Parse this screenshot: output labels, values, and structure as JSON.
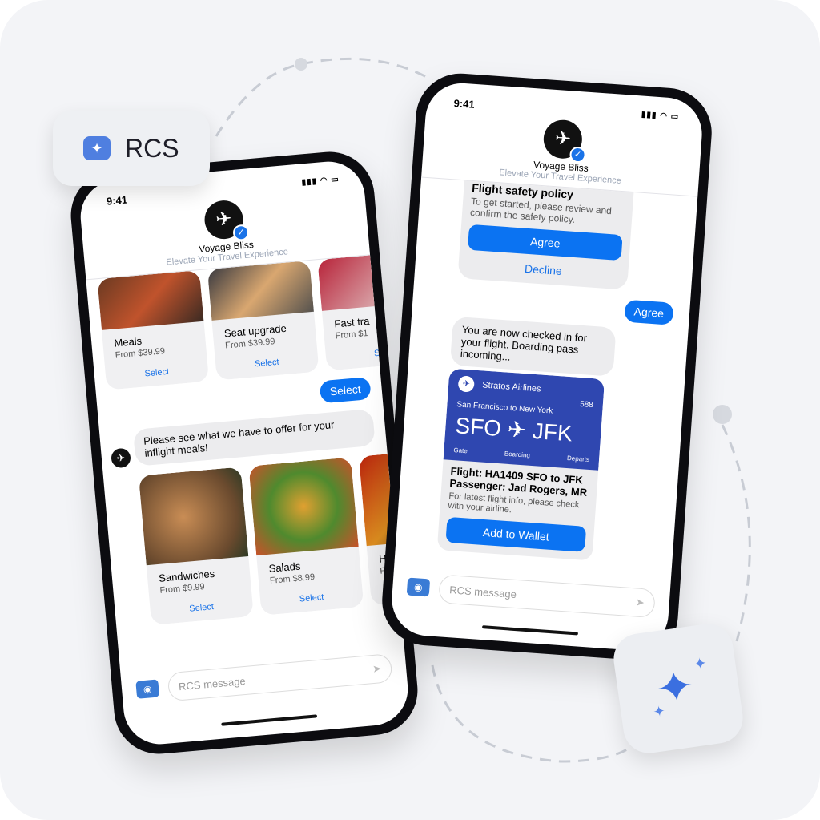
{
  "badge": {
    "label": "RCS",
    "icon": "chat-sparkle-icon"
  },
  "brand": {
    "name": "Voyage Bliss",
    "tagline": "Elevate Your Travel Experience",
    "accent": "#0b73f2"
  },
  "left_phone": {
    "time": "9:41",
    "top_cards": [
      {
        "title": "Meals",
        "price": "From $39.99",
        "action": "Select"
      },
      {
        "title": "Seat upgrade",
        "price": "From $39.99",
        "action": "Select"
      },
      {
        "title": "Fast tra",
        "price": "From $1",
        "action": "S"
      }
    ],
    "sent": "Select",
    "received": "Please see what we have to offer for your inflight meals!",
    "meal_cards": [
      {
        "title": "Sandwiches",
        "price": "From $9.99",
        "action": "Select"
      },
      {
        "title": "Salads",
        "price": "From $8.99",
        "action": "Select"
      },
      {
        "title": "Hot m",
        "price": "From",
        "action": ""
      }
    ],
    "input_placeholder": "RCS message"
  },
  "right_phone": {
    "time": "9:41",
    "policy": {
      "title": "Flight safety policy",
      "body": "To get started, please review and confirm the safety policy.",
      "agree": "Agree",
      "decline": "Decline"
    },
    "sent": "Agree",
    "received": "You are now checked in for your flight. Boarding pass incoming...",
    "pass": {
      "airline": "Stratos Airlines",
      "number": "588",
      "route": "San Francisco to New York",
      "from": "SFO",
      "to": "JFK",
      "gate": "Gate",
      "boarding": "Boarding",
      "departs": "Departs",
      "color": "#2f47b0"
    },
    "details": {
      "flight": "Flight: HA1409 SFO to JFK",
      "passenger": "Passenger: Jad Rogers, MR",
      "note": "For latest flight info, please check with your airline.",
      "wallet": "Add to Wallet"
    },
    "input_placeholder": "RCS message"
  }
}
